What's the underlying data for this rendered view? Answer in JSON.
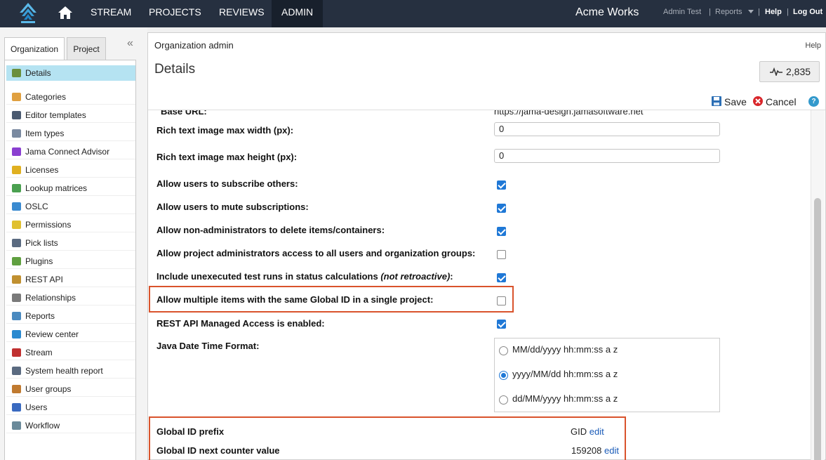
{
  "nav": {
    "items": [
      "STREAM",
      "PROJECTS",
      "REVIEWS",
      "ADMIN"
    ],
    "active": "ADMIN",
    "org_name": "Acme Works",
    "user": "Admin Test",
    "reports": "Reports",
    "help": "Help",
    "logout": "Log Out"
  },
  "sidebar": {
    "tabs": [
      "Organization",
      "Project"
    ],
    "items": [
      {
        "label": "Details",
        "icon": "details-icon",
        "selected": true
      },
      {
        "label": "Categories",
        "icon": "tag-icon"
      },
      {
        "label": "Editor templates",
        "icon": "template-icon"
      },
      {
        "label": "Item types",
        "icon": "item-types-icon"
      },
      {
        "label": "Jama Connect Advisor",
        "icon": "advisor-icon"
      },
      {
        "label": "Licenses",
        "icon": "key-icon"
      },
      {
        "label": "Lookup matrices",
        "icon": "matrix-icon"
      },
      {
        "label": "OSLC",
        "icon": "oslc-icon"
      },
      {
        "label": "Permissions",
        "icon": "shield-icon"
      },
      {
        "label": "Pick lists",
        "icon": "list-icon"
      },
      {
        "label": "Plugins",
        "icon": "puzzle-icon"
      },
      {
        "label": "REST API",
        "icon": "api-icon"
      },
      {
        "label": "Relationships",
        "icon": "link-icon"
      },
      {
        "label": "Reports",
        "icon": "chart-icon"
      },
      {
        "label": "Review center",
        "icon": "review-icon"
      },
      {
        "label": "Stream",
        "icon": "speech-icon"
      },
      {
        "label": "System health report",
        "icon": "health-icon"
      },
      {
        "label": "User groups",
        "icon": "users-icon"
      },
      {
        "label": "Users",
        "icon": "user-icon"
      },
      {
        "label": "Workflow",
        "icon": "workflow-icon"
      }
    ]
  },
  "main": {
    "breadcrumb": "Organization admin",
    "help": "Help",
    "title": "Details",
    "activity_count": "2,835",
    "save": "Save",
    "cancel": "Cancel",
    "partial_label": "Base URL:",
    "partial_value": "https://jama-design.jamasoftware.net",
    "fields": {
      "img_max_width": {
        "label": "Rich text image max width (px):",
        "value": "0"
      },
      "img_max_height": {
        "label": "Rich text image max height (px):",
        "value": "0"
      },
      "subscribe_others": {
        "label": "Allow users to subscribe others:",
        "checked": true
      },
      "mute_subscriptions": {
        "label": "Allow users to mute subscriptions:",
        "checked": true
      },
      "nonadmin_delete": {
        "label": "Allow non-administrators to delete items/containers:",
        "checked": true
      },
      "project_admin_access": {
        "label": "Allow project administrators access to all users and organization groups:",
        "checked": false
      },
      "unexecuted_runs": {
        "label": "Include unexecuted test runs in status calculations",
        "note": "(not retroactive)",
        "checked": true
      },
      "multi_global_id": {
        "label": "Allow multiple items with the same Global ID in a single project:",
        "checked": false
      },
      "rest_managed": {
        "label": "REST API Managed Access is enabled:",
        "checked": true
      },
      "date_format": {
        "label": "Java Date Time Format:",
        "options": [
          "MM/dd/yyyy hh:mm:ss a z",
          "yyyy/MM/dd hh:mm:ss a z",
          "dd/MM/yyyy hh:mm:ss a z"
        ],
        "selected": "yyyy/MM/dd hh:mm:ss a z"
      },
      "global_id_prefix": {
        "label": "Global ID prefix",
        "value": "GID",
        "edit": "edit"
      },
      "global_id_counter": {
        "label": "Global ID next counter value",
        "value": "159208",
        "edit": "edit"
      }
    }
  },
  "colors": {
    "nav_bg": "#263040",
    "selected_bg": "#b5e3f2",
    "highlight": "#d9532c",
    "check": "#1f78d6"
  }
}
